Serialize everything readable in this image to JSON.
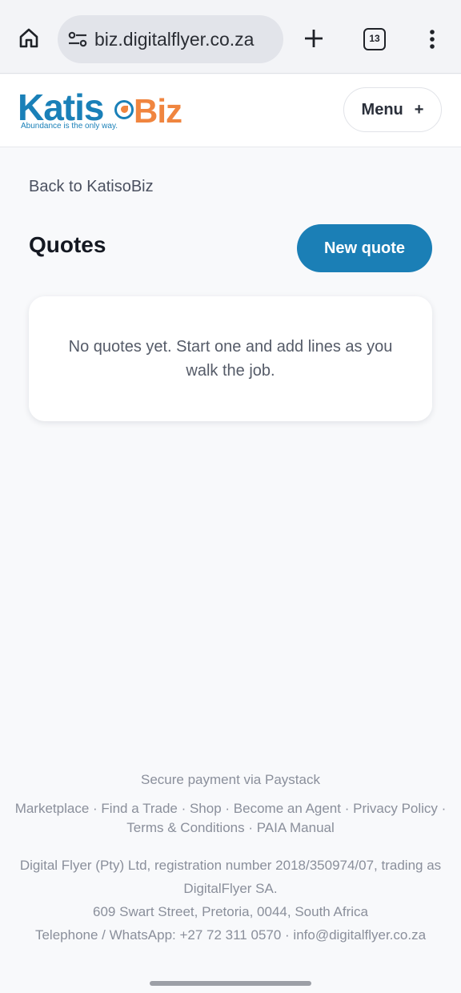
{
  "browser": {
    "url": "biz.digitalflyer.co.za",
    "tab_count": "13",
    "icons": [
      "home-icon",
      "page-info-icon",
      "new-tab-plus-icon",
      "tabs-icon",
      "more-vert-icon"
    ]
  },
  "header": {
    "logo_main": "Katis",
    "logo_accent": "Biz",
    "logo_tagline": "Abundance is the only way.",
    "menu_label": "Menu",
    "menu_icon": "+"
  },
  "main": {
    "back_link": "Back to KatisoBiz",
    "title": "Quotes",
    "new_quote_label": "New quote",
    "empty_message": "No quotes yet. Start one and add lines as you walk the job."
  },
  "footer": {
    "payment": "Secure payment via Paystack",
    "links": [
      "Marketplace",
      "Find a Trade",
      "Shop",
      "Become an Agent",
      "Privacy Policy",
      "Terms & Conditions",
      "PAIA Manual"
    ],
    "company_line1": "Digital Flyer (Pty) Ltd, registration number 2018/350974/07, trading as",
    "company_line2": "DigitalFlyer SA.",
    "address": "609 Swart Street, Pretoria, 0044, South Africa",
    "contact": "Telephone / WhatsApp: +27 72 311 0570 · info@digitalflyer.co.za"
  },
  "colors": {
    "brand_blue": "#1b7fb6",
    "brand_orange": "#f0853f",
    "page_bg": "#f8f9fb"
  }
}
